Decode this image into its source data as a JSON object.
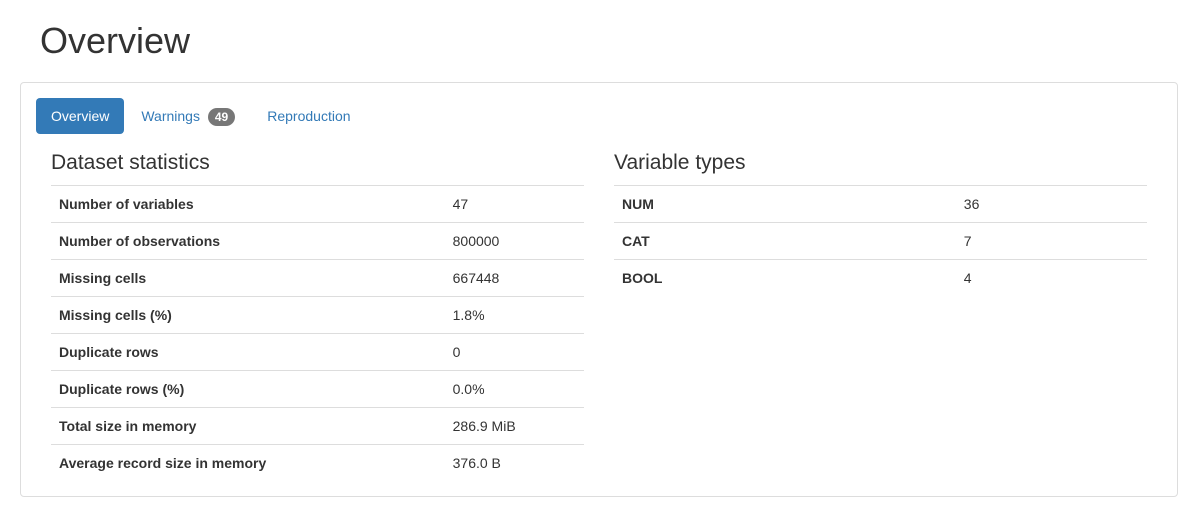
{
  "header": {
    "title": "Overview"
  },
  "tabs": {
    "overview": "Overview",
    "warnings": "Warnings",
    "warnings_count": "49",
    "reproduction": "Reproduction"
  },
  "dataset_stats": {
    "title": "Dataset statistics",
    "rows": [
      {
        "label": "Number of variables",
        "value": "47"
      },
      {
        "label": "Number of observations",
        "value": "800000"
      },
      {
        "label": "Missing cells",
        "value": "667448"
      },
      {
        "label": "Missing cells (%)",
        "value": "1.8%"
      },
      {
        "label": "Duplicate rows",
        "value": "0"
      },
      {
        "label": "Duplicate rows (%)",
        "value": "0.0%"
      },
      {
        "label": "Total size in memory",
        "value": "286.9 MiB"
      },
      {
        "label": "Average record size in memory",
        "value": "376.0 B"
      }
    ]
  },
  "variable_types": {
    "title": "Variable types",
    "rows": [
      {
        "label": "NUM",
        "value": "36"
      },
      {
        "label": "CAT",
        "value": "7"
      },
      {
        "label": "BOOL",
        "value": "4"
      }
    ]
  }
}
